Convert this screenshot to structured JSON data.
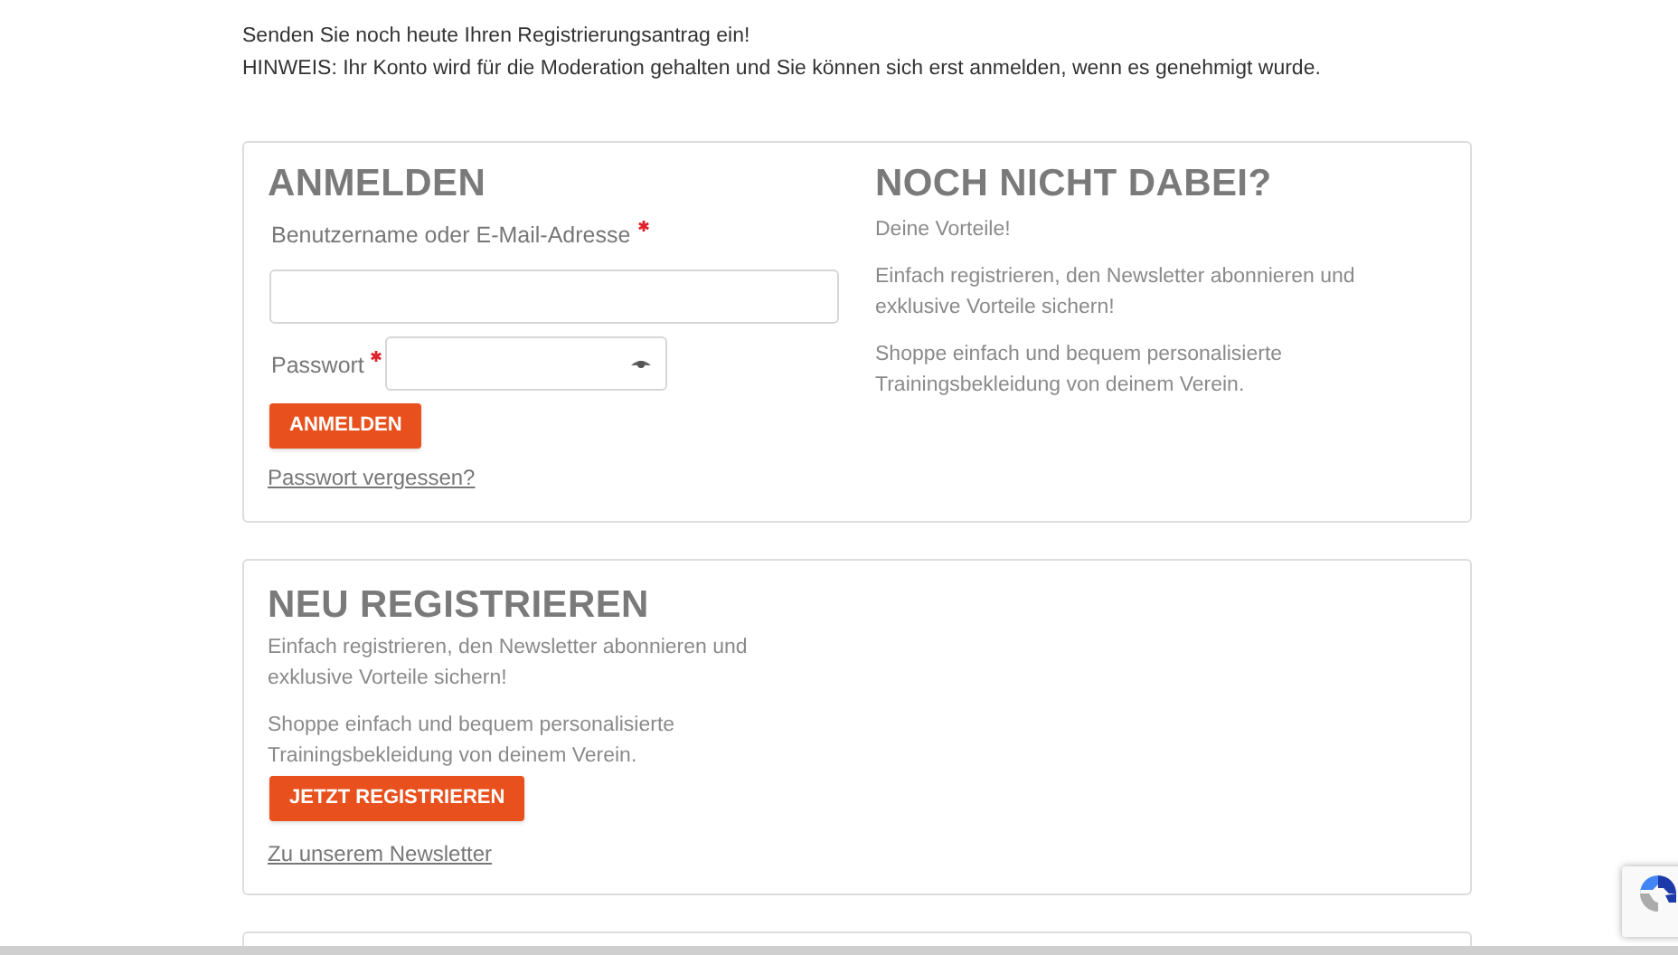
{
  "intro": {
    "lines": [
      "Senden Sie noch heute Ihren Registrierungsantrag ein!",
      "HINWEIS: Ihr Konto wird für die Moderation gehalten und Sie können sich erst anmelden, wenn es genehmigt wurde."
    ]
  },
  "login": {
    "title": "ANMELDEN",
    "fields": [
      {
        "kind": "text",
        "label": "Benutzername oder E-Mail-Adresse",
        "required": true
      },
      {
        "kind": "password",
        "label": "Passwort",
        "required": true
      }
    ],
    "button": "ANMELDEN",
    "link": "Passwort vergessen?"
  },
  "benefits": {
    "title": "NOCH NICHT DABEI?",
    "paragraphs": [
      "Deine Vorteile!",
      "Einfach registrieren, den Newsletter abonnieren und exklusive Vorteile sichern!",
      "Shoppe einfach und bequem personalisierte Trainingsbekleidung von deinem Verein."
    ]
  },
  "register": {
    "title": "NEU REGISTRIEREN",
    "paragraphs": [
      "Einfach registrieren, den Newsletter abonnieren und exklusive Vorteile sichern!",
      "Shoppe einfach und bequem personalisierte Trainingsbekleidung von deinem Verein."
    ],
    "button": "JETZT REGISTRIEREN",
    "link": "Zu unserem Newsletter"
  }
}
